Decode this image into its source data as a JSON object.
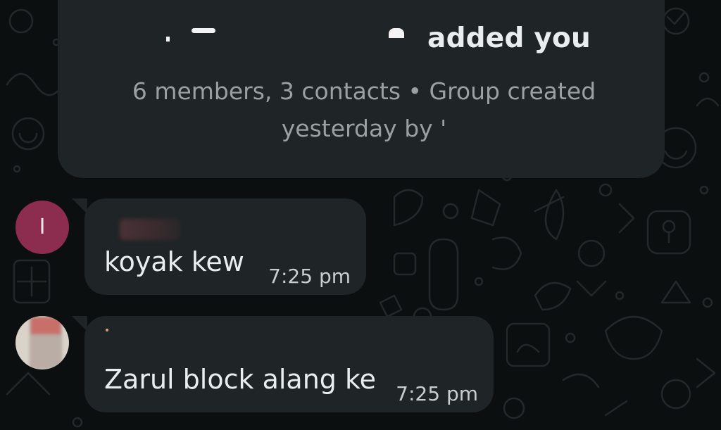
{
  "system_message": {
    "added_text": "added you",
    "info_text": "6 members, 3 contacts • Group created yesterday by '"
  },
  "messages": [
    {
      "avatar_initial": "I",
      "avatar_color": "#8c2c4f",
      "text": "koyak kew",
      "time": "7:25 pm"
    },
    {
      "avatar_initial": "",
      "text": "Zarul block alang ke",
      "time": "7:25 pm"
    }
  ],
  "colors": {
    "background": "#0c0f10",
    "bubble": "#1f2426",
    "text_primary": "#e9edef",
    "text_secondary": "#9aa0a3"
  }
}
